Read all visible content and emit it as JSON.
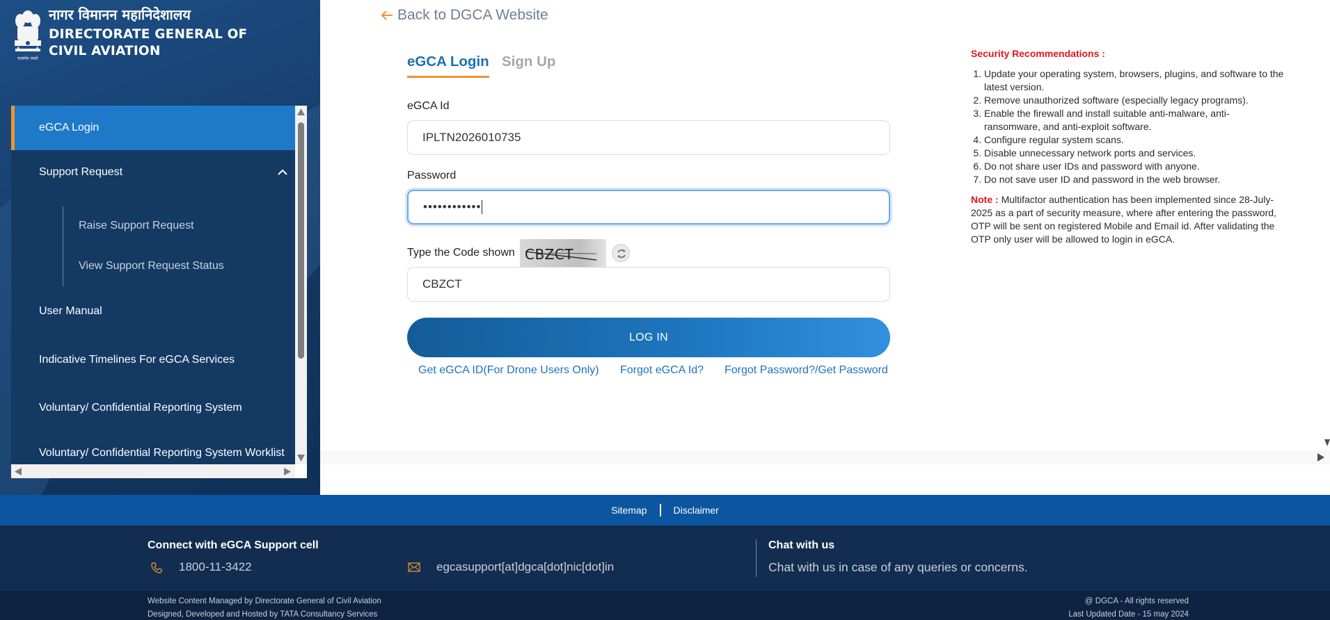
{
  "brand": {
    "hindi_name": "नागर विमानन महानिदेशालय",
    "english_name_line1": "DIRECTORATE GENERAL OF",
    "english_name_line2": "CIVIL AVIATION",
    "emblem_icon": "national-emblem-icon",
    "emblem_caption": "सत्यमेव जयते"
  },
  "sidebar": {
    "items": [
      {
        "label": "eGCA Login",
        "active": true
      },
      {
        "label": "Support Request",
        "expanded": true,
        "icon": "chevron-up-icon"
      },
      {
        "label": "Raise Support Request"
      },
      {
        "label": "View Support Request Status"
      },
      {
        "label": "User Manual"
      },
      {
        "label": "Indicative Timelines For eGCA Services"
      },
      {
        "label": "Voluntary/ Confidential Reporting System"
      },
      {
        "label": "Voluntary/ Confidential Reporting System Worklist"
      }
    ]
  },
  "back_link": {
    "label": "Back to DGCA Website",
    "icon": "arrow-left-icon",
    "icon_color": "#f0952b"
  },
  "tabs": [
    {
      "label": "eGCA Login",
      "active": true
    },
    {
      "label": "Sign Up",
      "active": false
    }
  ],
  "form": {
    "egca_id_label": "eGCA Id",
    "egca_id_value": "IPLTN2026010735",
    "password_label": "Password",
    "password_value": "••••••••••••",
    "captcha_label": "Type the Code shown",
    "captcha_image_text": "CBZCT",
    "captcha_value": "CBZCT",
    "refresh_icon": "refresh-icon",
    "login_button": "LOG IN"
  },
  "links": {
    "get_id": "Get eGCA ID(For Drone Users Only)",
    "forgot_id": "Forgot eGCA Id?",
    "forgot_password": "Forgot Password?/Get Password"
  },
  "security": {
    "title": "Security Recommendations :",
    "items": [
      "Update your operating system, browsers, plugins, and software to the latest version.",
      "Remove unauthorized software (especially legacy programs).",
      "Enable the firewall and install suitable anti-malware, anti-ransomware, and anti-exploit software.",
      "Configure regular system scans.",
      "Disable unnecessary network ports and services.",
      "Do not share user IDs and password with anyone.",
      "Do not save user ID and password in the web browser."
    ],
    "note_label": "Note :",
    "note_text": "Multifactor authentication has been implemented since 28-July-2025 as a part of security measure, where after entering the password, OTP will be sent on registered Mobile and Email id. After validating the OTP only user will be allowed to login in eGCA."
  },
  "footer": {
    "sitemap": "Sitemap",
    "disclaimer": "Disclaimer",
    "support_title": "Connect with eGCA Support cell",
    "phone_icon": "phone-icon",
    "phone": "1800-11-3422",
    "mail_icon": "mail-icon",
    "email": "egcasupport[at]dgca[dot]nic[dot]in",
    "chat_title": "Chat with us",
    "chat_text": "Chat with us in case of any queries or concerns.",
    "managed_by": "Website Content Managed by Directorate General of Civil Aviation",
    "designed_by": "Designed, Developed and Hosted by TATA Consultancy Services",
    "rights": "@ DGCA - All rights reserved",
    "last_updated": "Last Updated Date - 15 may 2024"
  },
  "colors": {
    "accent_orange": "#f0952b",
    "primary_blue": "#1c6fb6",
    "sidebar_bg": "#143963",
    "warning_red": "#e3141b"
  }
}
